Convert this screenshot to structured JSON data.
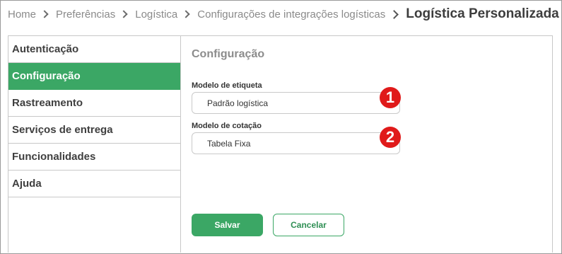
{
  "breadcrumb": {
    "items": [
      "Home",
      "Preferências",
      "Logística",
      "Configurações de integrações logísticas"
    ],
    "current": "Logística Personalizada"
  },
  "sidebar": {
    "items": [
      {
        "label": "Autenticação",
        "active": false
      },
      {
        "label": "Configuração",
        "active": true
      },
      {
        "label": "Rastreamento",
        "active": false
      },
      {
        "label": "Serviços de entrega",
        "active": false
      },
      {
        "label": "Funcionalidades",
        "active": false
      },
      {
        "label": "Ajuda",
        "active": false
      }
    ]
  },
  "main": {
    "title": "Configuração",
    "fields": [
      {
        "label": "Modelo de etiqueta",
        "value": "Padrão logística",
        "marker": "1"
      },
      {
        "label": "Modelo de cotação",
        "value": "Tabela Fixa",
        "marker": "2"
      }
    ],
    "save_label": "Salvar",
    "cancel_label": "Cancelar"
  },
  "colors": {
    "accent": "#3ba765",
    "marker": "#e01a1a"
  }
}
